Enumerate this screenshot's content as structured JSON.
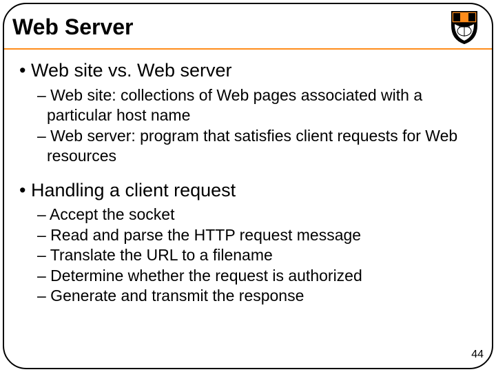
{
  "slide": {
    "title": "Web Server",
    "bullet1": "• Web site vs. Web server",
    "sub1a": "– Web site: collections of Web pages associated with a particular host name",
    "sub1b": "– Web server: program that satisfies client requests for Web resources",
    "bullet2": "• Handling a client request",
    "sub2a": "– Accept the socket",
    "sub2b": "– Read and parse the HTTP request message",
    "sub2c": "– Translate the URL to a filename",
    "sub2d": "– Determine whether the request is authorized",
    "sub2e": "– Generate and transmit the response",
    "page_number": "44"
  }
}
